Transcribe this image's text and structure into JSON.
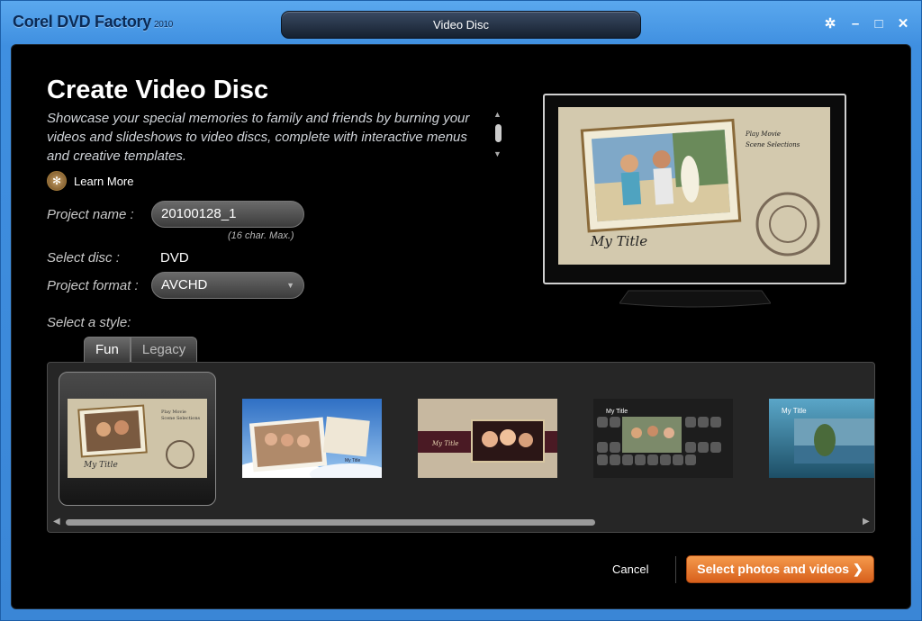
{
  "app": {
    "title": "Corel DVD Factory",
    "version": "2010",
    "window_title": "Video Disc"
  },
  "window_controls": {
    "settings_icon": "gear-icon",
    "minimize": "–",
    "maximize": "□",
    "close": "✕"
  },
  "header": {
    "title": "Create Video Disc",
    "description": "Showcase your special memories to family and friends by burning your videos and slideshows to video discs, complete with interactive menus and creative templates.",
    "learn_more": "Learn More"
  },
  "form": {
    "project_name_label": "Project name :",
    "project_name_value": "20100128_1",
    "project_name_hint": "(16 char. Max.)",
    "select_disc_label": "Select disc :",
    "select_disc_value": "DVD",
    "project_format_label": "Project format :",
    "project_format_value": "AVCHD",
    "select_style_label": "Select a style:"
  },
  "style_tabs": [
    {
      "label": "Fun",
      "active": true
    },
    {
      "label": "Legacy",
      "active": false
    }
  ],
  "preview": {
    "menu_items": [
      "Play Movie",
      "Scene Selections"
    ],
    "title": "My Title"
  },
  "thumbnails": [
    {
      "title": "My Title",
      "selected": true,
      "bg": "#cfc4a8"
    },
    {
      "title": "My Title",
      "selected": false,
      "bg": "#3f7fd0"
    },
    {
      "title": "My Title",
      "selected": false,
      "bg": "#c7b8a0"
    },
    {
      "title": "My Title",
      "selected": false,
      "bg": "#222222"
    },
    {
      "title": "My Title",
      "selected": false,
      "bg": "#4a8aa8"
    }
  ],
  "footer": {
    "cancel": "Cancel",
    "primary": "Select photos and videos ❯"
  },
  "colors": {
    "accent": "#e07a2e",
    "panel": "#000000",
    "frame": "#3f8fe0"
  }
}
